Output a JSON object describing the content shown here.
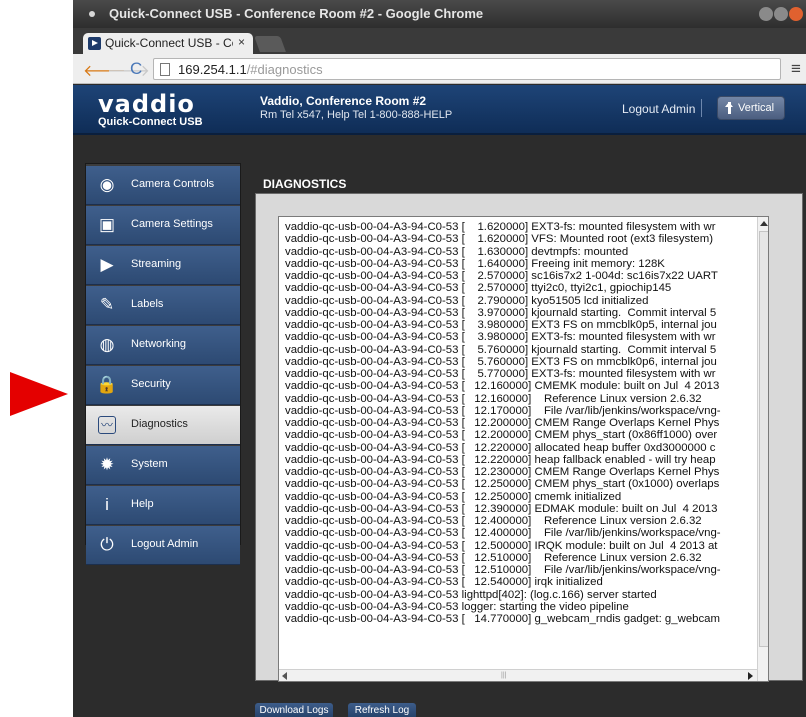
{
  "window": {
    "title": "Quick-Connect USB - Conference Room #2 - Google Chrome",
    "controls": {
      "minimize": "minimize-icon",
      "maximize": "maximize-icon",
      "close": "close-icon"
    }
  },
  "tab": {
    "title": "Quick-Connect USB - Co",
    "close": "×"
  },
  "toolbar": {
    "back": "🡐",
    "forward": "🡒",
    "reload": "C",
    "menu": "≡",
    "url_host": "169.254.1.1",
    "url_path": "/#diagnostics"
  },
  "header": {
    "logo": "vaddio",
    "product": "Quick-Connect USB",
    "room_name": "Vaddio, Conference Room #2",
    "room_phone": "Rm Tel x547, Help Tel 1-800-888-HELP",
    "logout": "Logout Admin",
    "vertical_button": "Vertical"
  },
  "sidebar": {
    "items": [
      {
        "label": "Camera Controls",
        "icon": "camera-controls-icon",
        "glyph": "◉",
        "active": false
      },
      {
        "label": "Camera Settings",
        "icon": "camera-settings-icon",
        "glyph": "▣",
        "active": false
      },
      {
        "label": "Streaming",
        "icon": "streaming-icon",
        "glyph": "▶",
        "active": false
      },
      {
        "label": "Labels",
        "icon": "labels-icon",
        "glyph": "✎",
        "active": false
      },
      {
        "label": "Networking",
        "icon": "networking-icon",
        "glyph": "◍",
        "active": false
      },
      {
        "label": "Security",
        "icon": "security-icon",
        "glyph": "🔒",
        "active": false
      },
      {
        "label": "Diagnostics",
        "icon": "diagnostics-icon",
        "glyph": "〰",
        "active": true
      },
      {
        "label": "System",
        "icon": "system-icon",
        "glyph": "✹",
        "active": false
      },
      {
        "label": "Help",
        "icon": "help-icon",
        "glyph": "i",
        "active": false
      },
      {
        "label": "Logout Admin",
        "icon": "logout-icon",
        "glyph": "⏻",
        "active": false
      }
    ]
  },
  "diagnostics": {
    "title": "DIAGNOSTICS",
    "log": [
      "vaddio-qc-usb-00-04-A3-94-C0-53 [    1.620000] EXT3-fs: mounted filesystem with wr",
      "vaddio-qc-usb-00-04-A3-94-C0-53 [    1.620000] VFS: Mounted root (ext3 filesystem)",
      "vaddio-qc-usb-00-04-A3-94-C0-53 [    1.630000] devtmpfs: mounted",
      "vaddio-qc-usb-00-04-A3-94-C0-53 [    1.640000] Freeing init memory: 128K",
      "vaddio-qc-usb-00-04-A3-94-C0-53 [    2.570000] sc16is7x2 1-004d: sc16is7x22 UART",
      "vaddio-qc-usb-00-04-A3-94-C0-53 [    2.570000] ttyi2c0, ttyi2c1, gpiochip145",
      "vaddio-qc-usb-00-04-A3-94-C0-53 [    2.790000] kyo51505 lcd initialized",
      "vaddio-qc-usb-00-04-A3-94-C0-53 [    3.970000] kjournald starting.  Commit interval 5",
      "vaddio-qc-usb-00-04-A3-94-C0-53 [    3.980000] EXT3 FS on mmcblk0p5, internal jou",
      "vaddio-qc-usb-00-04-A3-94-C0-53 [    3.980000] EXT3-fs: mounted filesystem with wr",
      "vaddio-qc-usb-00-04-A3-94-C0-53 [    5.760000] kjournald starting.  Commit interval 5",
      "vaddio-qc-usb-00-04-A3-94-C0-53 [    5.760000] EXT3 FS on mmcblk0p6, internal jou",
      "vaddio-qc-usb-00-04-A3-94-C0-53 [    5.770000] EXT3-fs: mounted filesystem with wr",
      "vaddio-qc-usb-00-04-A3-94-C0-53 [   12.160000] CMEMK module: built on Jul  4 2013",
      "vaddio-qc-usb-00-04-A3-94-C0-53 [   12.160000]    Reference Linux version 2.6.32",
      "vaddio-qc-usb-00-04-A3-94-C0-53 [   12.170000]    File /var/lib/jenkins/workspace/vng-",
      "vaddio-qc-usb-00-04-A3-94-C0-53 [   12.200000] CMEM Range Overlaps Kernel Phys",
      "vaddio-qc-usb-00-04-A3-94-C0-53 [   12.200000] CMEM phys_start (0x86ff1000) over",
      "vaddio-qc-usb-00-04-A3-94-C0-53 [   12.220000] allocated heap buffer 0xd3000000 c",
      "vaddio-qc-usb-00-04-A3-94-C0-53 [   12.220000] heap fallback enabled - will try heap",
      "vaddio-qc-usb-00-04-A3-94-C0-53 [   12.230000] CMEM Range Overlaps Kernel Phys",
      "vaddio-qc-usb-00-04-A3-94-C0-53 [   12.250000] CMEM phys_start (0x1000) overlaps",
      "vaddio-qc-usb-00-04-A3-94-C0-53 [   12.250000] cmemk initialized",
      "vaddio-qc-usb-00-04-A3-94-C0-53 [   12.390000] EDMAK module: built on Jul  4 2013",
      "vaddio-qc-usb-00-04-A3-94-C0-53 [   12.400000]    Reference Linux version 2.6.32",
      "vaddio-qc-usb-00-04-A3-94-C0-53 [   12.400000]    File /var/lib/jenkins/workspace/vng-",
      "vaddio-qc-usb-00-04-A3-94-C0-53 [   12.500000] IRQK module: built on Jul  4 2013 at",
      "vaddio-qc-usb-00-04-A3-94-C0-53 [   12.510000]    Reference Linux version 2.6.32",
      "vaddio-qc-usb-00-04-A3-94-C0-53 [   12.510000]    File /var/lib/jenkins/workspace/vng-",
      "vaddio-qc-usb-00-04-A3-94-C0-53 [   12.540000] irqk initialized",
      "vaddio-qc-usb-00-04-A3-94-C0-53 lighttpd[402]: (log.c.166) server started",
      "vaddio-qc-usb-00-04-A3-94-C0-53 logger: starting the video pipeline",
      "vaddio-qc-usb-00-04-A3-94-C0-53 [   14.770000] g_webcam_rndis gadget: g_webcam"
    ]
  },
  "actions": {
    "download": "Download Logs",
    "refresh": "Refresh Log"
  },
  "colors": {
    "pointer": "#e40000",
    "header": "#1e4477",
    "nav": "#3f5f8c"
  }
}
